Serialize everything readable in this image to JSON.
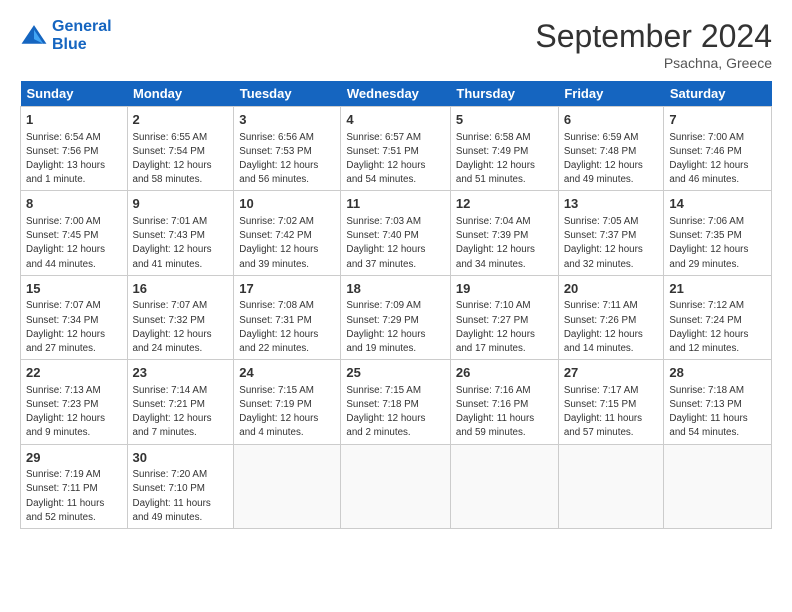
{
  "header": {
    "logo_line1": "General",
    "logo_line2": "Blue",
    "month": "September 2024",
    "location": "Psachna, Greece"
  },
  "days_of_week": [
    "Sunday",
    "Monday",
    "Tuesday",
    "Wednesday",
    "Thursday",
    "Friday",
    "Saturday"
  ],
  "weeks": [
    [
      {
        "num": "1",
        "rise": "6:54 AM",
        "set": "7:56 PM",
        "daylight": "13 hours and 1 minute."
      },
      {
        "num": "2",
        "rise": "6:55 AM",
        "set": "7:54 PM",
        "daylight": "12 hours and 58 minutes."
      },
      {
        "num": "3",
        "rise": "6:56 AM",
        "set": "7:53 PM",
        "daylight": "12 hours and 56 minutes."
      },
      {
        "num": "4",
        "rise": "6:57 AM",
        "set": "7:51 PM",
        "daylight": "12 hours and 54 minutes."
      },
      {
        "num": "5",
        "rise": "6:58 AM",
        "set": "7:49 PM",
        "daylight": "12 hours and 51 minutes."
      },
      {
        "num": "6",
        "rise": "6:59 AM",
        "set": "7:48 PM",
        "daylight": "12 hours and 49 minutes."
      },
      {
        "num": "7",
        "rise": "7:00 AM",
        "set": "7:46 PM",
        "daylight": "12 hours and 46 minutes."
      }
    ],
    [
      {
        "num": "8",
        "rise": "7:00 AM",
        "set": "7:45 PM",
        "daylight": "12 hours and 44 minutes."
      },
      {
        "num": "9",
        "rise": "7:01 AM",
        "set": "7:43 PM",
        "daylight": "12 hours and 41 minutes."
      },
      {
        "num": "10",
        "rise": "7:02 AM",
        "set": "7:42 PM",
        "daylight": "12 hours and 39 minutes."
      },
      {
        "num": "11",
        "rise": "7:03 AM",
        "set": "7:40 PM",
        "daylight": "12 hours and 37 minutes."
      },
      {
        "num": "12",
        "rise": "7:04 AM",
        "set": "7:39 PM",
        "daylight": "12 hours and 34 minutes."
      },
      {
        "num": "13",
        "rise": "7:05 AM",
        "set": "7:37 PM",
        "daylight": "12 hours and 32 minutes."
      },
      {
        "num": "14",
        "rise": "7:06 AM",
        "set": "7:35 PM",
        "daylight": "12 hours and 29 minutes."
      }
    ],
    [
      {
        "num": "15",
        "rise": "7:07 AM",
        "set": "7:34 PM",
        "daylight": "12 hours and 27 minutes."
      },
      {
        "num": "16",
        "rise": "7:07 AM",
        "set": "7:32 PM",
        "daylight": "12 hours and 24 minutes."
      },
      {
        "num": "17",
        "rise": "7:08 AM",
        "set": "7:31 PM",
        "daylight": "12 hours and 22 minutes."
      },
      {
        "num": "18",
        "rise": "7:09 AM",
        "set": "7:29 PM",
        "daylight": "12 hours and 19 minutes."
      },
      {
        "num": "19",
        "rise": "7:10 AM",
        "set": "7:27 PM",
        "daylight": "12 hours and 17 minutes."
      },
      {
        "num": "20",
        "rise": "7:11 AM",
        "set": "7:26 PM",
        "daylight": "12 hours and 14 minutes."
      },
      {
        "num": "21",
        "rise": "7:12 AM",
        "set": "7:24 PM",
        "daylight": "12 hours and 12 minutes."
      }
    ],
    [
      {
        "num": "22",
        "rise": "7:13 AM",
        "set": "7:23 PM",
        "daylight": "12 hours and 9 minutes."
      },
      {
        "num": "23",
        "rise": "7:14 AM",
        "set": "7:21 PM",
        "daylight": "12 hours and 7 minutes."
      },
      {
        "num": "24",
        "rise": "7:15 AM",
        "set": "7:19 PM",
        "daylight": "12 hours and 4 minutes."
      },
      {
        "num": "25",
        "rise": "7:15 AM",
        "set": "7:18 PM",
        "daylight": "12 hours and 2 minutes."
      },
      {
        "num": "26",
        "rise": "7:16 AM",
        "set": "7:16 PM",
        "daylight": "11 hours and 59 minutes."
      },
      {
        "num": "27",
        "rise": "7:17 AM",
        "set": "7:15 PM",
        "daylight": "11 hours and 57 minutes."
      },
      {
        "num": "28",
        "rise": "7:18 AM",
        "set": "7:13 PM",
        "daylight": "11 hours and 54 minutes."
      }
    ],
    [
      {
        "num": "29",
        "rise": "7:19 AM",
        "set": "7:11 PM",
        "daylight": "11 hours and 52 minutes."
      },
      {
        "num": "30",
        "rise": "7:20 AM",
        "set": "7:10 PM",
        "daylight": "11 hours and 49 minutes."
      },
      null,
      null,
      null,
      null,
      null
    ]
  ]
}
